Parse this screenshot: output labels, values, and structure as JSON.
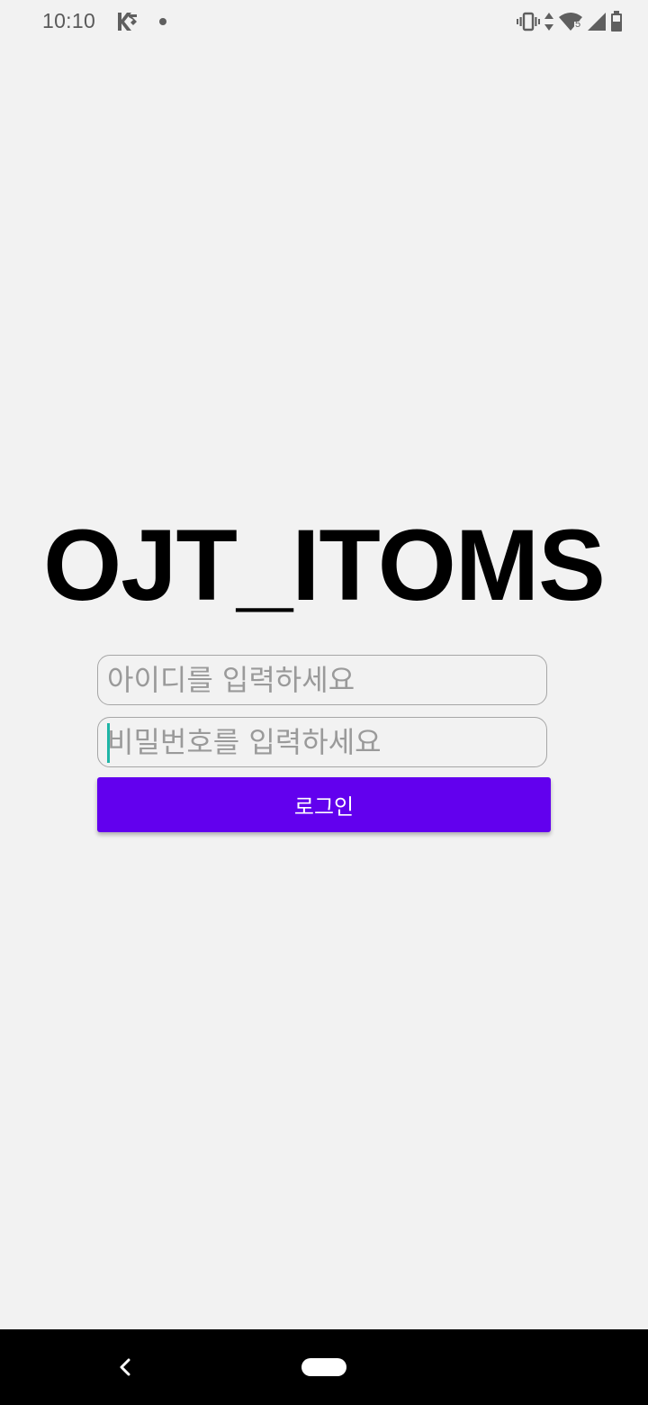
{
  "status_bar": {
    "time": "10:10",
    "icons": [
      "keyboard-app-icon",
      "notification-dot-icon",
      "vibrate-icon",
      "data-arrows-icon",
      "wifi-icon",
      "signal-icon",
      "battery-icon"
    ],
    "wifi_badge": "5"
  },
  "app": {
    "title": "OJT_ITOMS"
  },
  "login_form": {
    "id_placeholder": "아이디를 입력하세요",
    "id_value": "",
    "password_placeholder": "비밀번호를 입력하세요",
    "password_value": "",
    "login_label": "로그인"
  },
  "colors": {
    "background": "#f2f2f2",
    "primary": "#6200ee",
    "cursor": "#1fb5a6",
    "nav_bar": "#000000"
  }
}
